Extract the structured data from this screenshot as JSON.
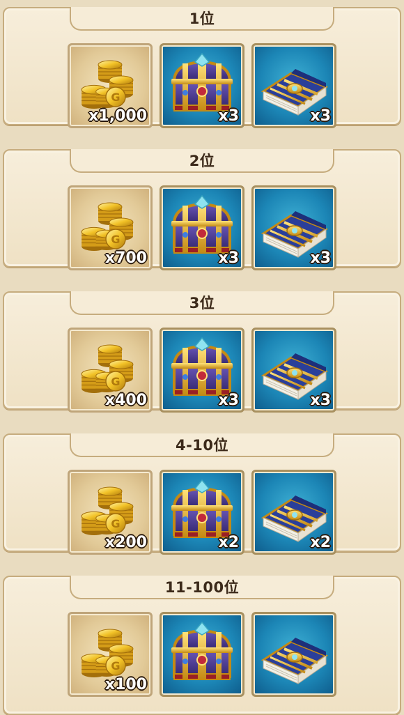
{
  "tiers": [
    {
      "rank": "1位",
      "items": [
        {
          "icon": "gold-coins-icon",
          "qty": "x1,000"
        },
        {
          "icon": "treasure-chest-icon",
          "qty": "x3"
        },
        {
          "icon": "spell-book-icon",
          "qty": "x3"
        }
      ]
    },
    {
      "rank": "2位",
      "items": [
        {
          "icon": "gold-coins-icon",
          "qty": "x700"
        },
        {
          "icon": "treasure-chest-icon",
          "qty": "x3"
        },
        {
          "icon": "spell-book-icon",
          "qty": "x3"
        }
      ]
    },
    {
      "rank": "3位",
      "items": [
        {
          "icon": "gold-coins-icon",
          "qty": "x400"
        },
        {
          "icon": "treasure-chest-icon",
          "qty": "x3"
        },
        {
          "icon": "spell-book-icon",
          "qty": "x3"
        }
      ]
    },
    {
      "rank": "4-10位",
      "items": [
        {
          "icon": "gold-coins-icon",
          "qty": "x200"
        },
        {
          "icon": "treasure-chest-icon",
          "qty": "x2"
        },
        {
          "icon": "spell-book-icon",
          "qty": "x2"
        }
      ]
    },
    {
      "rank": "11-100位",
      "items": [
        {
          "icon": "gold-coins-icon",
          "qty": "x100"
        },
        {
          "icon": "treasure-chest-icon",
          "qty": ""
        },
        {
          "icon": "spell-book-icon",
          "qty": ""
        }
      ]
    }
  ]
}
